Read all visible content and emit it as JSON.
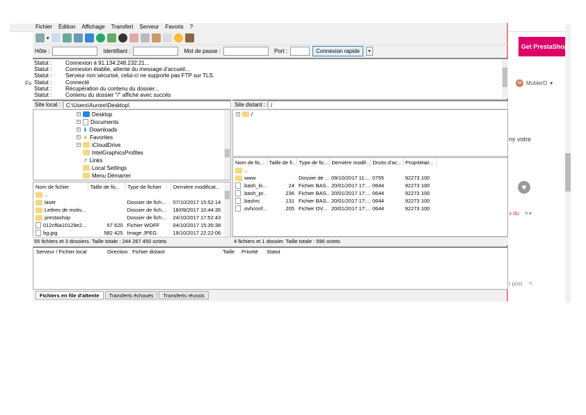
{
  "browser": {
    "cta": "Get PrestaShop",
    "user_initial": "M",
    "user_name": "MoblerD",
    "partial_text_1": "ns votre",
    "partial_text_2": "s du",
    "partial_text_3": "t post",
    "left_text": "Fo"
  },
  "menu": [
    "Fichier",
    "Édition",
    "Affichage",
    "Transfert",
    "Serveur",
    "Favoris",
    "?"
  ],
  "quickconnect": {
    "host_label": "Hôte :",
    "user_label": "Identifiant :",
    "pass_label": "Mot de passe :",
    "port_label": "Port :",
    "host": "",
    "user": "",
    "pass": "",
    "port": "",
    "button": "Connexion rapide"
  },
  "log": [
    {
      "k": "Statut :",
      "v": "Connexion à 91.134.248.232:21..."
    },
    {
      "k": "Statut :",
      "v": "Connexion établie, attente du message d'accueil..."
    },
    {
      "k": "Statut :",
      "v": "Serveur non sécurisé, celui-ci ne supporte pas FTP sur TLS."
    },
    {
      "k": "Statut :",
      "v": "Connecté"
    },
    {
      "k": "Statut :",
      "v": "Récupération du contenu du dossier..."
    },
    {
      "k": "Statut :",
      "v": "Contenu du dossier \"/\" affiché avec succès"
    }
  ],
  "local": {
    "label": "Site local :",
    "path": "C:\\Users\\Aurore\\Desktop\\",
    "tree": [
      "Desktop",
      "Documents",
      "Downloads",
      "Favorites",
      "iCloudDrive",
      "IntelGraphicsProfiles",
      "Links",
      "Local Settings",
      "Menu Démarrer"
    ],
    "columns": [
      "Nom de fichier",
      "Taille de fic...",
      "Type de fichier",
      "Dernière modificat..."
    ],
    "rows": [
      [
        "..",
        "",
        "",
        ""
      ],
      [
        "laser",
        "",
        "Dossier de fich...",
        "07/10/2017 15:52:14"
      ],
      [
        "Lettres de motiv...",
        "",
        "Dossier de fich...",
        "18/09/2017 10:44:35"
      ],
      [
        "prestashop",
        "",
        "Dossier de fich...",
        "24/10/2017 17:52:43"
      ],
      [
        "012cf6a10129e2...",
        "57 620",
        "Fichier WOFF",
        "04/10/2017 15:35:38"
      ],
      [
        "bg.jpg",
        "582 425",
        "Image JPEG",
        "19/10/2017 22:22:06"
      ]
    ],
    "status": "55 fichiers et 3 dossiers. Taille totale : 244 267 450 octets"
  },
  "remote": {
    "label": "Site distant :",
    "path": "/",
    "tree": [
      "/"
    ],
    "columns": [
      "Nom de fic...",
      "Taille de fi...",
      "Type de fic...",
      "Dernière modif...",
      "Droits d'ac...",
      "Propriétair..."
    ],
    "rows": [
      [
        "..",
        "",
        "",
        "",
        "",
        ""
      ],
      [
        "www",
        "",
        "Dossier de ...",
        "09/10/2017 11:...",
        "0755",
        "92273 100"
      ],
      [
        ".bash_lo...",
        "24",
        "Fichier BAS...",
        "20/01/2017 17:...",
        "0644",
        "92273 100"
      ],
      [
        ".bash_pr...",
        "236",
        "Fichier BAS...",
        "20/01/2017 17:...",
        "0644",
        "92273 100"
      ],
      [
        ".bashrc",
        "131",
        "Fichier BAS...",
        "20/01/2017 17:...",
        "0644",
        "92273 100"
      ],
      [
        ".ovhconf...",
        "205",
        "Fichier OV...",
        "20/01/2017 17:...",
        "0644",
        "92273 100"
      ]
    ],
    "status": "4 fichiers et 1 dossier. Taille totale : 596 octets"
  },
  "queue": {
    "columns": [
      "Serveur / Fichier local",
      "Direction",
      "Fichier distant",
      "Taille",
      "Priorité",
      "Statut"
    ],
    "tabs": [
      "Fichiers en file d'attente",
      "Transferts échoués",
      "Transferts réussis"
    ]
  },
  "colors": {
    "brand": "#df0067",
    "folder": "#f8d77a",
    "window_border": "#f08080"
  }
}
